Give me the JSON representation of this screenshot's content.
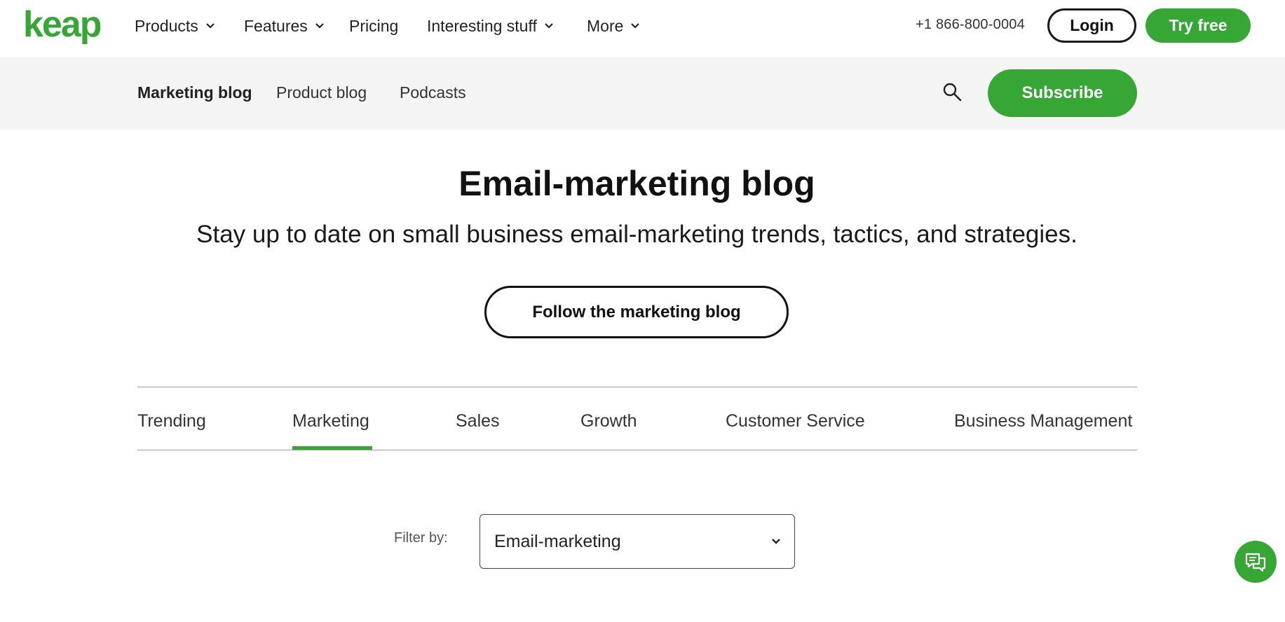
{
  "brand": {
    "logo_text": "keap",
    "accent_color": "#36a635"
  },
  "header": {
    "nav": [
      {
        "label": "Products",
        "has_dropdown": true
      },
      {
        "label": "Features",
        "has_dropdown": true
      },
      {
        "label": "Pricing",
        "has_dropdown": false
      },
      {
        "label": "Interesting stuff",
        "has_dropdown": true
      },
      {
        "label": "More",
        "has_dropdown": true
      }
    ],
    "phone": "+1 866-800-0004",
    "login_label": "Login",
    "try_free_label": "Try free"
  },
  "subnav": {
    "items": [
      {
        "label": "Marketing blog",
        "active": true
      },
      {
        "label": "Product blog",
        "active": false
      },
      {
        "label": "Podcasts",
        "active": false
      }
    ],
    "search_icon": "search-icon",
    "subscribe_label": "Subscribe"
  },
  "hero": {
    "title": "Email-marketing blog",
    "subtitle": "Stay up to date on small business email-marketing trends, tactics, and strategies.",
    "follow_label": "Follow the marketing blog"
  },
  "tabs": [
    {
      "label": "Trending",
      "active": false
    },
    {
      "label": "Marketing",
      "active": true
    },
    {
      "label": "Sales",
      "active": false
    },
    {
      "label": "Growth",
      "active": false
    },
    {
      "label": "Customer Service",
      "active": false
    },
    {
      "label": "Business Management",
      "active": false
    }
  ],
  "filter": {
    "label": "Filter by:",
    "selected": "Email-marketing"
  },
  "chat": {
    "icon": "chat-icon"
  }
}
